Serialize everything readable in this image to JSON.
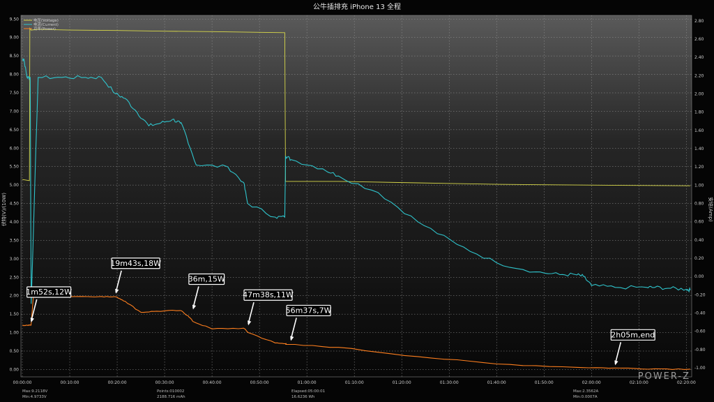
{
  "chart_data": {
    "type": "line",
    "title": "公牛插排充 iPhone  13    全程",
    "ylabel_left": "伏特(V)/(10W)",
    "ylabel_right": "安培(Amp)",
    "ylim_left": [
      -0.2,
      9.6
    ],
    "ylim_right": [
      -1.1,
      2.86
    ],
    "x_range_seconds": [
      0,
      8450
    ],
    "x_ticks": [
      "00:00:00",
      "00:10:00",
      "00:20:00",
      "00:30:00",
      "00:40:00",
      "00:50:00",
      "01:00:00",
      "01:10:00",
      "01:20:00",
      "01:30:00",
      "01:40:00",
      "01:50:00",
      "02:00:00",
      "02:10:00",
      "02:20:00"
    ],
    "y_ticks_left": [
      "9.50",
      "9.00",
      "8.50",
      "8.00",
      "7.50",
      "7.00",
      "6.50",
      "6.00",
      "5.50",
      "5.00",
      "4.50",
      "4.00",
      "3.50",
      "3.00",
      "2.50",
      "2.00",
      "1.50",
      "1.00",
      "0.50",
      "0.00"
    ],
    "y_ticks_right": [
      "2.80",
      "2.60",
      "2.40",
      "2.20",
      "2.00",
      "1.80",
      "1.60",
      "1.40",
      "1.20",
      "1.00",
      "0.80",
      "0.60",
      "0.40",
      "0.20",
      "0.00",
      "-0.20",
      "-0.40",
      "-0.60",
      "-0.80",
      "-1.00"
    ],
    "grid": true,
    "legend_position": "top-left",
    "series": [
      {
        "name": "电压(Voltage)",
        "color": "#d8d84a",
        "axis": "left",
        "x": [
          0,
          90,
          95,
          110,
          200,
          600,
          1200,
          1800,
          2400,
          3000,
          3320,
          3330,
          4000,
          5000,
          6000,
          7000,
          8450
        ],
        "y": [
          5.15,
          5.12,
          9.25,
          9.2,
          9.22,
          9.2,
          9.19,
          9.17,
          9.16,
          9.14,
          9.13,
          5.1,
          5.1,
          5.06,
          5.02,
          5.0,
          4.98
        ]
      },
      {
        "name": "电流(Current)",
        "color": "#2fc4cc",
        "axis": "right",
        "x": [
          0,
          20,
          60,
          100,
          112,
          200,
          500,
          800,
          1000,
          1180,
          1300,
          1450,
          1600,
          1750,
          1900,
          2000,
          2050,
          2200,
          2600,
          2800,
          2850,
          3200,
          3320,
          3330,
          3400,
          3800,
          4000,
          4500,
          5000,
          5500,
          6000,
          6500,
          6800,
          7000,
          7100,
          7200,
          7500,
          7900,
          8000,
          8200,
          8400,
          8450
        ],
        "y": [
          2.38,
          2.38,
          2.18,
          2.18,
          -0.3,
          2.18,
          2.18,
          2.18,
          2.18,
          2.0,
          1.95,
          1.8,
          1.65,
          1.68,
          1.72,
          1.68,
          1.6,
          1.22,
          1.2,
          1.03,
          0.8,
          0.65,
          0.65,
          1.32,
          1.28,
          1.18,
          1.1,
          0.92,
          0.6,
          0.35,
          0.15,
          0.05,
          0.02,
          0.02,
          0.0,
          -0.1,
          -0.12,
          -0.12,
          -0.12,
          -0.13,
          -0.14,
          -0.15
        ]
      },
      {
        "name": "功率(Power)",
        "color": "#ff7f1e",
        "axis": "left",
        "x": [
          0,
          60,
          110,
          140,
          500,
          1000,
          1200,
          1300,
          1500,
          1700,
          2000,
          2100,
          2160,
          2400,
          2800,
          2860,
          3200,
          3330,
          3340,
          4000,
          5000,
          6000,
          7000,
          7500,
          8000,
          8450
        ],
        "y": [
          1.2,
          1.2,
          1.2,
          1.98,
          1.98,
          1.98,
          1.96,
          1.85,
          1.55,
          1.58,
          1.6,
          1.45,
          1.3,
          1.1,
          1.12,
          1.0,
          0.72,
          0.7,
          0.68,
          0.6,
          0.35,
          0.15,
          0.06,
          0.04,
          0.02,
          0.01
        ]
      }
    ],
    "annotations": [
      {
        "label": "1m52s,12W",
        "x": 112,
        "y": 1.2
      },
      {
        "label": "19m43s,18W",
        "x": 1183,
        "y": 1.98
      },
      {
        "label": "36m,15W",
        "x": 2160,
        "y": 1.55
      },
      {
        "label": "47m38s,11W",
        "x": 2858,
        "y": 1.12
      },
      {
        "label": "56m37s,7W",
        "x": 3397,
        "y": 0.7
      },
      {
        "label": "2h05m,end",
        "x": 7500,
        "y": 0.04
      }
    ]
  },
  "footer": {
    "stat1_a": "Max:9.2118V",
    "stat1_b": "Min:4.9733V",
    "stat2_a": "Points:010002",
    "stat2_b": "2188.716 mAh",
    "stat3_a": "Elapsed:05:00:01",
    "stat3_b": "16.6236 Wh",
    "stat4_a": "Max:2.3562A",
    "stat4_b": "Min:0.0007A",
    "brand": "POWER-Z"
  }
}
